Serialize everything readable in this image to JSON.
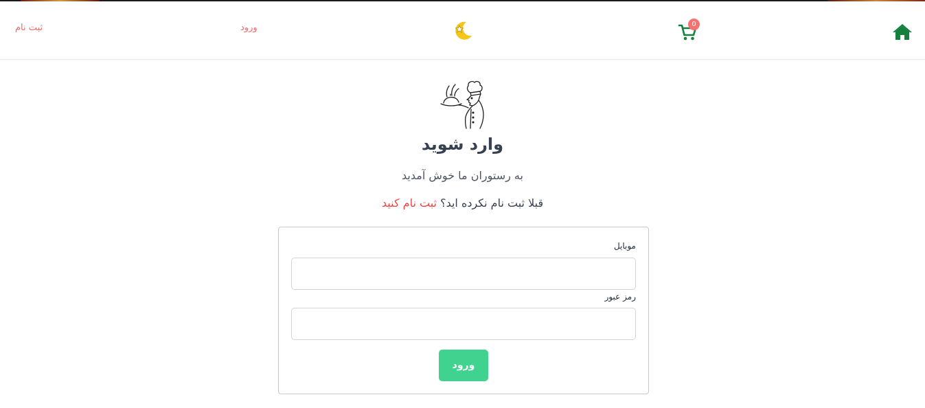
{
  "nav": {
    "register_label": "ثبت نام",
    "login_label": "ورود",
    "cart_count": "0",
    "theme_icon": "moon-star-icon",
    "cart_icon": "cart-icon",
    "home_icon": "home-icon"
  },
  "hero": {
    "logo_icon": "chef-icon",
    "title": "وارد شوید",
    "welcome": "به رستوران ما خوش آمدید",
    "no_account_text": "قبلا ثبت نام نکرده اید؟",
    "register_link": "ثبت نام کنید"
  },
  "form": {
    "mobile_label": "موبایل",
    "mobile_value": "",
    "password_label": "رمز عبور",
    "password_value": "",
    "submit_label": "ورود"
  },
  "colors": {
    "accent_red": "#ef6b6b",
    "accent_green": "#3fd38f",
    "home_green": "#15803d",
    "moon_yellow": "#f5c518"
  }
}
